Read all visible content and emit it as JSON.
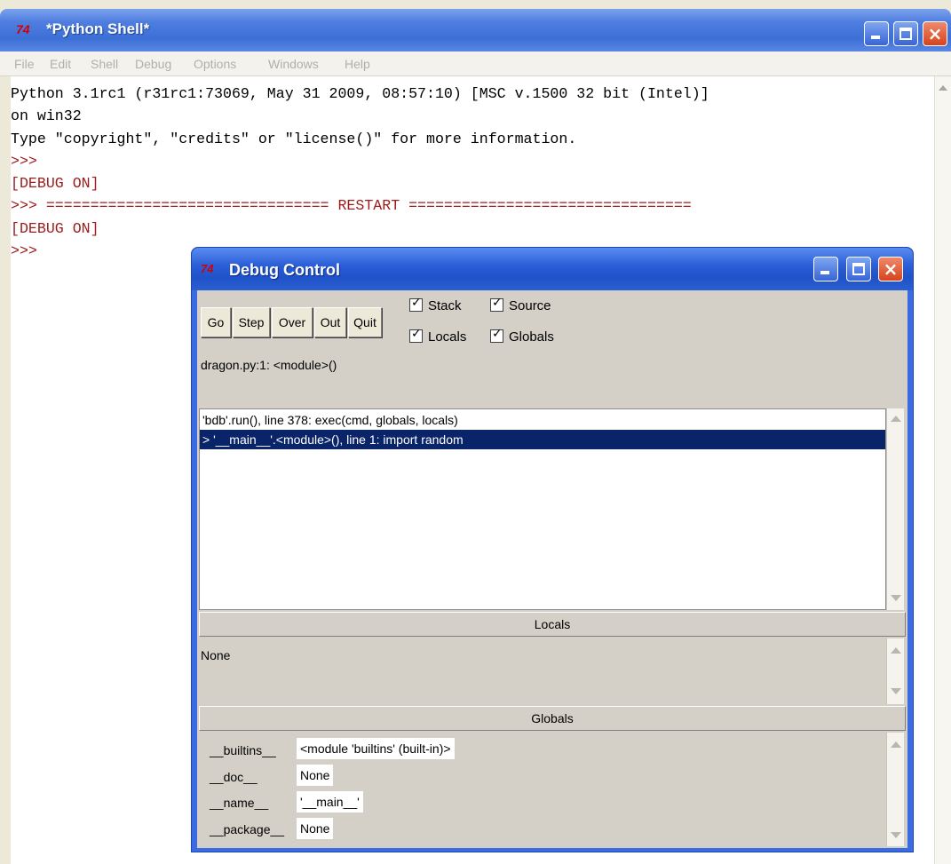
{
  "shell": {
    "title": "*Python Shell*",
    "logo": "74",
    "menu": [
      "File",
      "Edit",
      "Shell",
      "Debug",
      "Options",
      "Windows",
      "Help"
    ],
    "lines": [
      {
        "text": "Python 3.1rc1 (r31rc1:73069, May 31 2009, 08:57:10) [MSC v.1500 32 bit (Intel)]",
        "kind": "out"
      },
      {
        "text": "on win32",
        "kind": "out"
      },
      {
        "text": "Type \"copyright\", \"credits\" or \"license()\" for more information.",
        "kind": "out"
      },
      {
        "text": ">>> ",
        "kind": "prompt"
      },
      {
        "text": "[DEBUG ON]",
        "kind": "debug"
      },
      {
        "text": ">>> ================================ RESTART ================================",
        "kind": "prompt"
      },
      {
        "text": "[DEBUG ON]",
        "kind": "debug"
      },
      {
        "text": ">>> ",
        "kind": "prompt"
      }
    ]
  },
  "debug": {
    "title": "Debug Control",
    "logo": "74",
    "buttons": [
      "Go",
      "Step",
      "Over",
      "Out",
      "Quit"
    ],
    "checks": {
      "stack": "Stack",
      "source": "Source",
      "locals": "Locals",
      "globals": "Globals"
    },
    "status": "dragon.py:1: <module>()",
    "stack": [
      "'bdb'.run(), line 378: exec(cmd, globals, locals)",
      "> '__main__'.<module>(), line 1: import random"
    ],
    "locals_header": "Locals",
    "locals_value": "None",
    "globals_header": "Globals",
    "globals": [
      {
        "name": "__builtins__",
        "value": "<module 'builtins' (built-in)>"
      },
      {
        "name": "__doc__",
        "value": "None"
      },
      {
        "name": "__name__",
        "value": "'__main__'"
      },
      {
        "name": "__package__",
        "value": "None"
      }
    ]
  }
}
